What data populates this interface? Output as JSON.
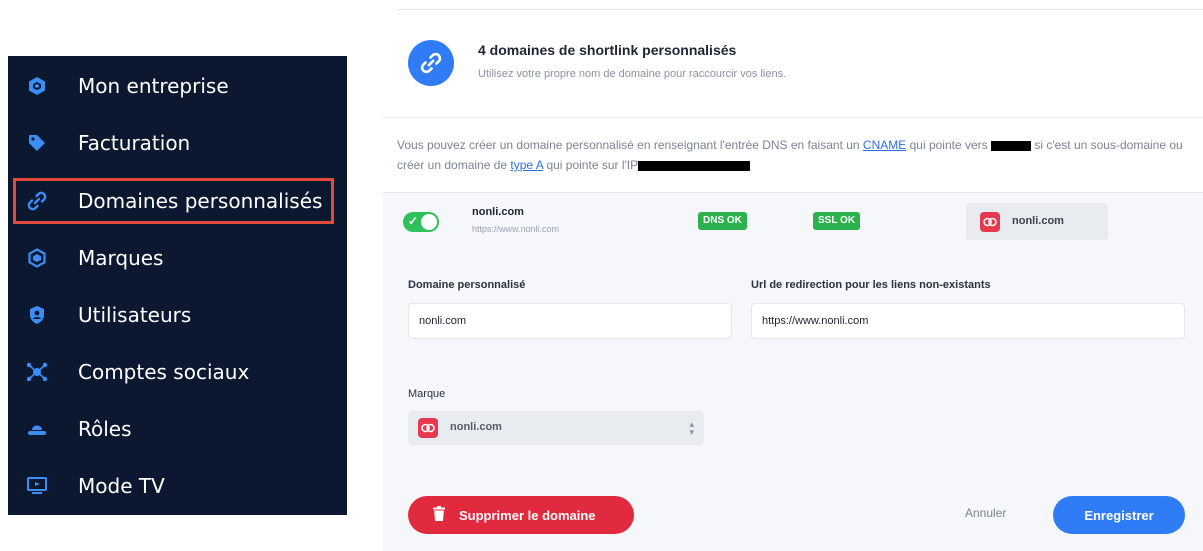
{
  "sidebar": {
    "items": [
      {
        "label": "Mon entreprise",
        "icon": "cube-icon"
      },
      {
        "label": "Facturation",
        "icon": "tag-icon"
      },
      {
        "label": "Domaines personnalisés",
        "icon": "link-icon",
        "active": true
      },
      {
        "label": "Marques",
        "icon": "cube-outline-icon"
      },
      {
        "label": "Utilisateurs",
        "icon": "shield-user-icon"
      },
      {
        "label": "Comptes sociaux",
        "icon": "network-icon"
      },
      {
        "label": "Rôles",
        "icon": "hat-icon"
      },
      {
        "label": "Mode TV",
        "icon": "tv-icon"
      }
    ]
  },
  "header": {
    "title": "4 domaines de shortlink personnalisés",
    "subtitle": "Utilisez votre propre nom de domaine pour raccourcir vos liens."
  },
  "info": {
    "part1": "Vous pouvez créer un domaine personnalisé en renseignant l'entrée DNS en faisant un ",
    "link1": "CNAME",
    "part2": " qui pointe vers ",
    "part3": " si c'est un sous-domaine ou créer un domaine de ",
    "link2": "type A",
    "part4": " qui pointe sur l'IP"
  },
  "domain": {
    "name": "nonli.com",
    "url": "https://www.nonli.com",
    "enabled": true,
    "dns_status": "DNS OK",
    "ssl_status": "SSL OK",
    "brand": "nonli.com"
  },
  "form": {
    "domain_label": "Domaine personnalisé",
    "domain_value": "nonli.com",
    "redirect_label": "Url de redirection pour les liens non-existants",
    "redirect_value": "https://www.nonli.com",
    "brand_label": "Marque",
    "brand_value": "nonli.com"
  },
  "actions": {
    "delete": "Supprimer le domaine",
    "cancel": "Annuler",
    "save": "Enregistrer"
  },
  "colors": {
    "sidebar_bg": "#0b1830",
    "accent_blue": "#2f7cf6",
    "active_outline": "#e24a3b",
    "success_green": "#2bb24c",
    "danger_red": "#e22a3e",
    "brand_red": "#e8384f"
  }
}
